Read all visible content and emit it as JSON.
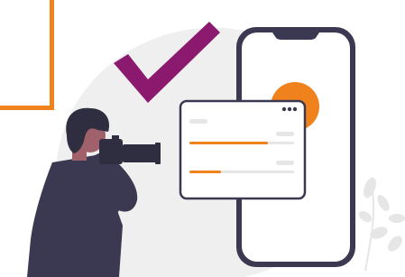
{
  "illustration": {
    "subject": "photographer-with-phone-app",
    "colors": {
      "accent_orange": "#F0821E",
      "check_purple": "#8B1A6E",
      "dark_navy": "#3B3851",
      "blob_gray": "#EFEFEF",
      "card_border": "#3B3851",
      "skin": "#A0616A",
      "hair": "#2F2E41",
      "bar_track": "#E6E6E6",
      "plant": "#E6E6E6"
    },
    "icons": [
      "checkmark-icon",
      "dots-menu-icon"
    ],
    "progress": {
      "bar_1_fraction": 0.75,
      "bar_2_fraction": 0.3
    }
  }
}
